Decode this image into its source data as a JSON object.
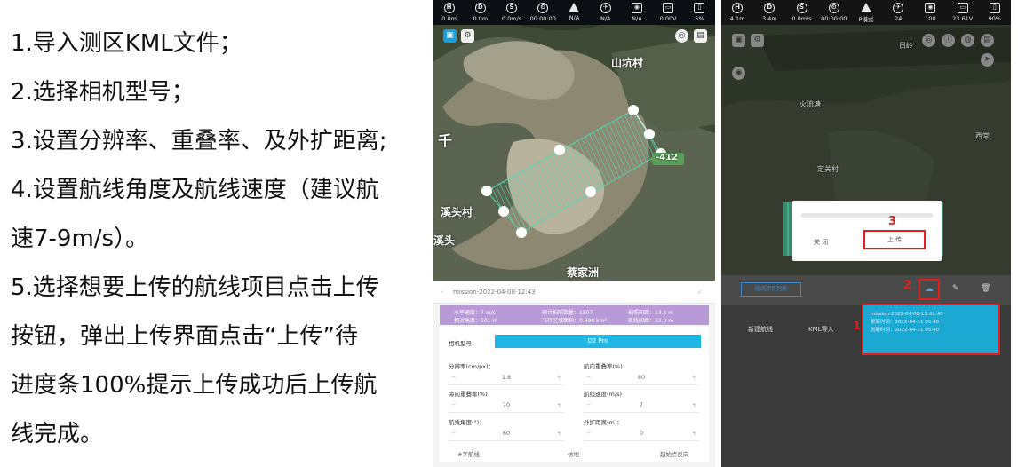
{
  "instructions": [
    "1.导入测区KML文件；",
    "2.选择相机型号；",
    "3.设置分辨率、重叠率、及外扩距离;",
    "4.设置航线角度及航线速度（建议航",
    "速7-9m/s）。",
    "5.选择想要上传的航线项目点击上传",
    "按钮，弹出上传界面点击“上传”待",
    "进度条100%提示上传成功后上传航",
    "线完成。"
  ],
  "phone1": {
    "status": [
      {
        "icon": "H",
        "value": "0.0m"
      },
      {
        "icon": "D",
        "value": "0.0m"
      },
      {
        "icon": "S",
        "value": "0.0m/s"
      },
      {
        "icon": "⏲",
        "value": "00:00:00"
      },
      {
        "icon": "▲",
        "value": "N/A"
      },
      {
        "icon": "✈",
        "value": "N/A"
      },
      {
        "icon": "◉",
        "value": "N/A"
      },
      {
        "icon": "▭",
        "value": "0.00V"
      },
      {
        "icon": "▯",
        "value": "5%"
      }
    ],
    "map_labels": {
      "village1": "山坑村",
      "village2": "溪头村",
      "village3": "溪头",
      "place": "蔡家洲",
      "road": "-412",
      "left": "千"
    },
    "mission_name": "mission-2022-04-08-12:43",
    "stats": {
      "horizontal_speed": "水平速度：7 m/s",
      "relative_height": "相对高度：101 m",
      "photo_count": "预计拍照数量：1507",
      "area": "飞行区域面积：0.698 km²",
      "shoot_interval": "拍照间距：14.4 m",
      "route_interval": "航线间距：32.0 m"
    },
    "settings": {
      "camera_label": "相机型号：",
      "camera_value": "D2 Pro",
      "resolution_label": "分辨率(cm/px)：",
      "resolution_value": "1.8",
      "heading_overlap_label": "航向重叠率(%)",
      "heading_overlap_value": "80",
      "side_overlap_label": "旁向重叠率(%)：",
      "side_overlap_value": "70",
      "speed_label": "航线速度(m/s)",
      "speed_value": "7",
      "angle_label": "航线角度(°)：",
      "angle_value": "60",
      "expand_label": "外扩距离(m)：",
      "expand_value": "0",
      "minus": "−",
      "plus": "+",
      "opt1": "#字航线",
      "opt2": "仿地",
      "opt3": "起始点反向"
    }
  },
  "phone2": {
    "status": [
      {
        "icon": "H",
        "value": "4.1m"
      },
      {
        "icon": "D",
        "value": "3.4m"
      },
      {
        "icon": "S",
        "value": "0.0m/s"
      },
      {
        "icon": "⏲",
        "value": "00:00:00"
      },
      {
        "icon": "▲",
        "value": "P模式"
      },
      {
        "icon": "✈",
        "value": "24"
      },
      {
        "icon": "◉",
        "value": "100"
      },
      {
        "icon": "▭",
        "value": "23.61V"
      },
      {
        "icon": "▯",
        "value": "90%"
      }
    ],
    "map_labels": {
      "a": "火流塘",
      "b": "定关村",
      "c": "西堂",
      "d": "日岭"
    },
    "dialog": {
      "close_label": "关 闭",
      "upload_label": "上 传"
    },
    "toolbar": {
      "selector_label": "航线项目列表",
      "upload_icon": "☁",
      "edit_icon": "✎",
      "delete_icon": "🗑"
    },
    "new_route_label": "新建航线",
    "kml_import_label": "KML导入",
    "mission_card": {
      "title": "mission-2022-04-08-11:41:40",
      "created": "更新时间：2022-04-11 05:40",
      "modified": "创建时间：2022-04-11 05:40"
    },
    "markers": {
      "m1": "1",
      "m2": "2",
      "m3": "3"
    }
  }
}
